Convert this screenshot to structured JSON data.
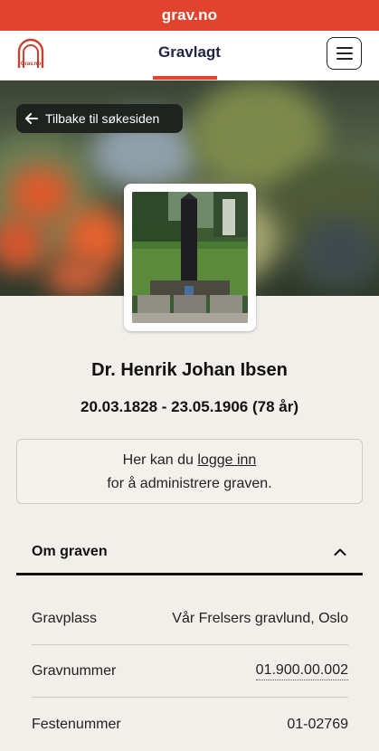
{
  "topbar": {
    "site": "grav.no"
  },
  "header": {
    "logo_text": "Grav.no",
    "title": "Gravlagt",
    "menu_icon": "hamburger-icon"
  },
  "hero": {
    "back_label": "Tilbake til søkesiden",
    "back_icon": "arrow-left-icon"
  },
  "person": {
    "name": "Dr. Henrik Johan Ibsen",
    "dates": "20.03.1828 - 23.05.1906 (78 år)"
  },
  "login": {
    "text_before": "Her kan du ",
    "link": "logge inn",
    "text_after": "for å administrere graven."
  },
  "section": {
    "title": "Om graven",
    "toggle_icon": "chevron-up-icon",
    "rows": [
      {
        "label": "Gravplass",
        "value": "Vår Frelsers gravlund,  Oslo"
      },
      {
        "label": "Gravnummer",
        "value": "01.900.00.002"
      },
      {
        "label": "Festenummer",
        "value": "01-02769"
      }
    ]
  },
  "colors": {
    "brand": "#e0442c",
    "header_title": "#1f2440",
    "background": "#f2efea"
  }
}
